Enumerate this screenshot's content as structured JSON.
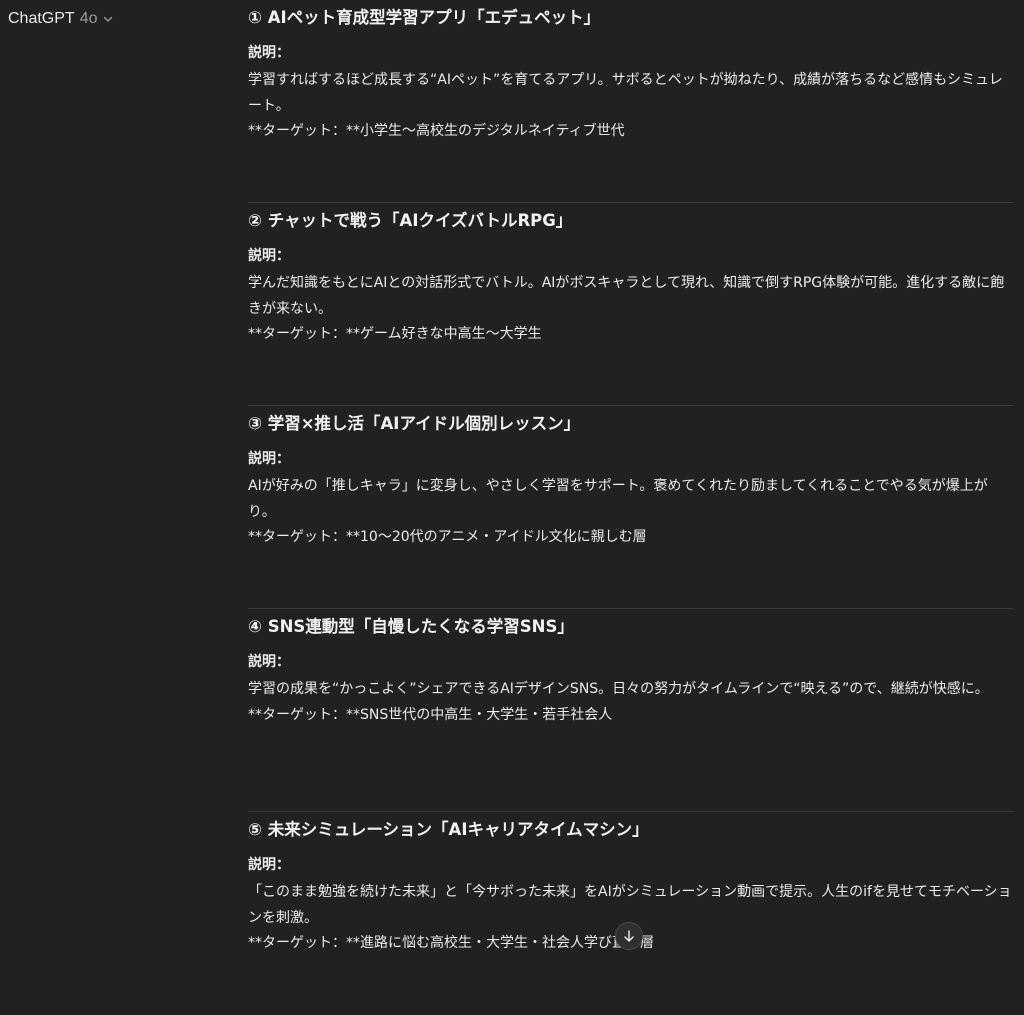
{
  "header": {
    "model_name": "ChatGPT",
    "model_version": "4o"
  },
  "sections": [
    {
      "title": "① AIペット育成型学習アプリ「エデュペット」",
      "label": "説明：",
      "description": "学習すればするほど成長する“AIペット”を育てるアプリ。サボるとペットが拗ねたり、成績が落ちるなど感情もシミュレート。",
      "target": "**ターゲット：**小学生〜高校生のデジタルネイティブ世代"
    },
    {
      "title": "② チャットで戦う「AIクイズバトルRPG」",
      "label": "説明：",
      "description": "学んだ知識をもとにAIとの対話形式でバトル。AIがボスキャラとして現れ、知識で倒すRPG体験が可能。進化する敵に飽きが来ない。",
      "target": "**ターゲット：**ゲーム好きな中高生〜大学生"
    },
    {
      "title": "③ 学習×推し活「AIアイドル個別レッスン」",
      "label": "説明：",
      "description": "AIが好みの「推しキャラ」に変身し、やさしく学習をサポート。褒めてくれたり励ましてくれることでやる気が爆上がり。",
      "target": "**ターゲット：**10〜20代のアニメ・アイドル文化に親しむ層"
    },
    {
      "title": "④ SNS連動型「自慢したくなる学習SNS」",
      "label": "説明：",
      "description": "学習の成果を“かっこよく”シェアできるAIデザインSNS。日々の努力がタイムラインで“映える”ので、継続が快感に。",
      "target": "**ターゲット：**SNS世代の中高生・大学生・若手社会人"
    },
    {
      "title": "⑤ 未来シミュレーション「AIキャリアタイムマシン」",
      "label": "説明：",
      "description": "「このまま勉強を続けた未来」と「今サボった未来」をAIがシミュレーション動画で提示。人生のifを見せてモチベーションを刺激。",
      "target": "**ターゲット：**進路に悩む高校生・大学生・社会人学び直し層"
    }
  ],
  "scroll_button": {
    "icon": "arrow-down-icon"
  }
}
